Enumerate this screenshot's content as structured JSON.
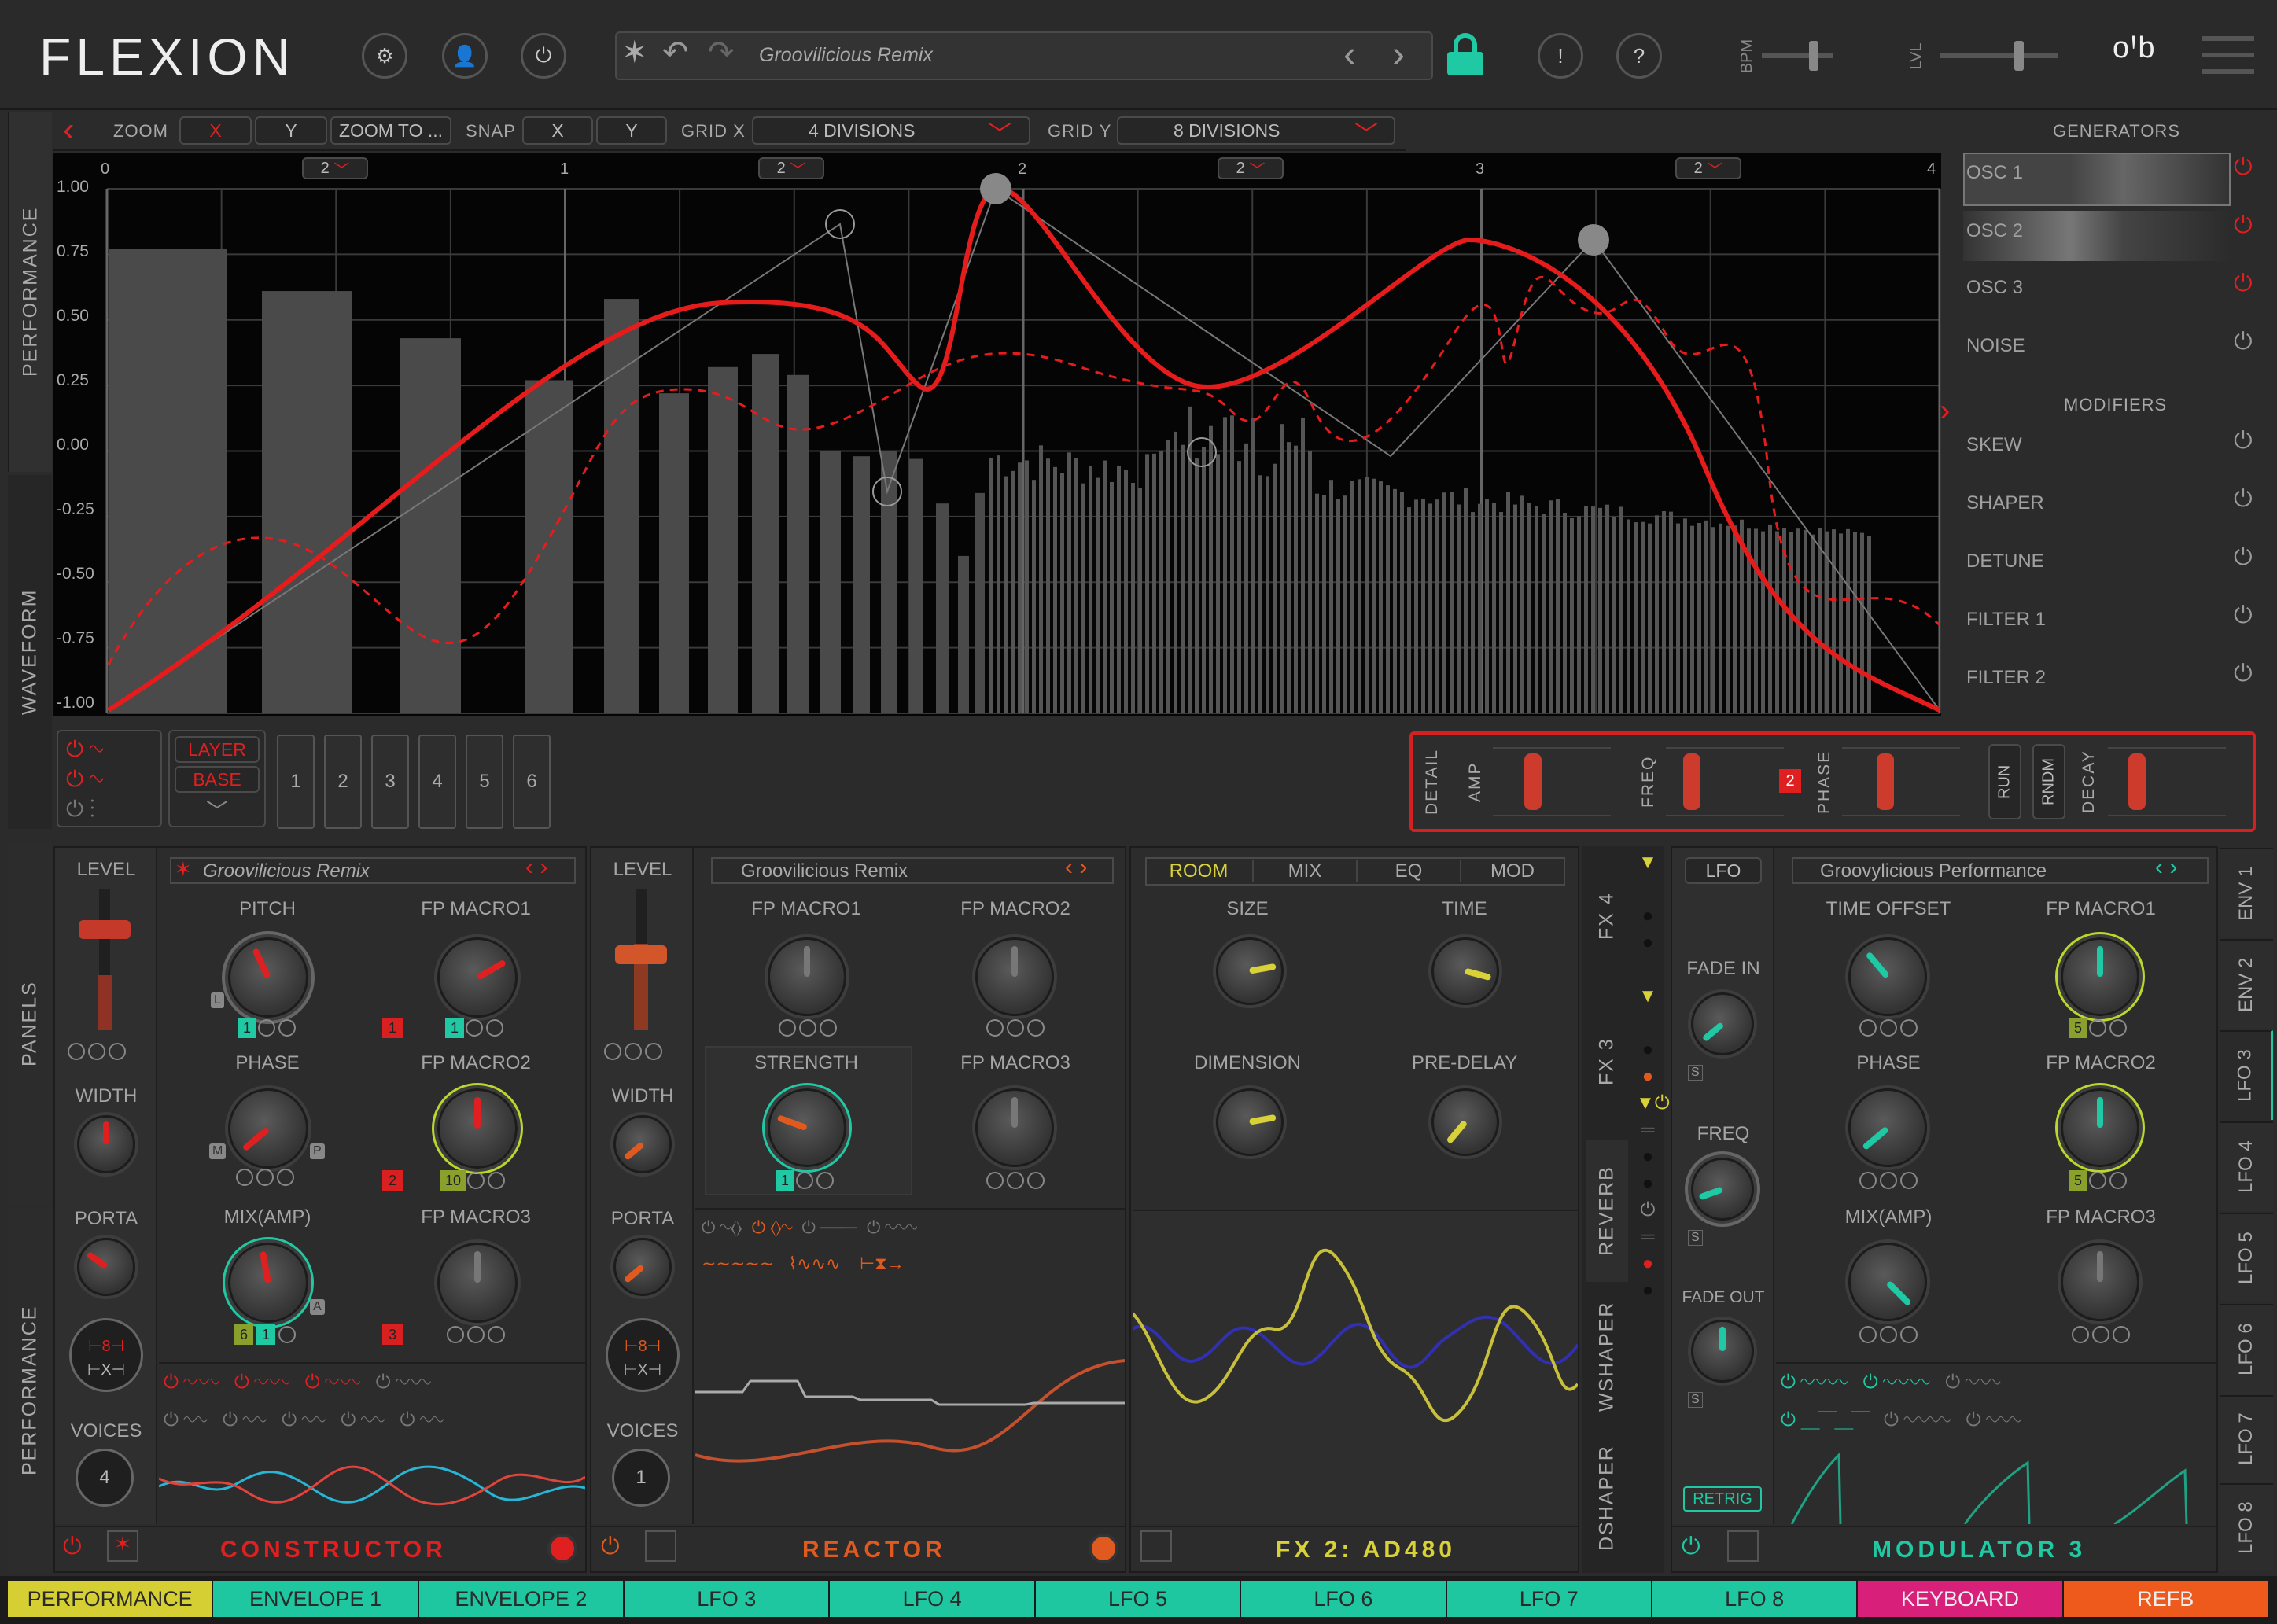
{
  "app": {
    "logo": "FLEXION",
    "preset": "Groovilicious Remix",
    "bpm_label": "BPM",
    "lvl_label": "LVL",
    "warn": "!",
    "help": "?"
  },
  "colors": {
    "accent": "#e02020",
    "teal": "#1fc9a4",
    "yellow": "#d8d238",
    "pink": "#e0237e",
    "orange": "#ee5a1c"
  },
  "toolbar": {
    "zoom": "ZOOM",
    "zoom_x": "X",
    "zoom_y": "Y",
    "zoom_to": "ZOOM TO ...",
    "snap": "SNAP",
    "snap_x": "X",
    "snap_y": "Y",
    "gridx": "GRID X",
    "gridx_val": "4 DIVISIONS",
    "gridy": "GRID Y",
    "gridy_val": "8 DIVISIONS"
  },
  "graph": {
    "x_ticks": [
      "0",
      "1",
      "2",
      "3",
      "4"
    ],
    "y_ticks": [
      "1.00",
      "0.75",
      "0.50",
      "0.25",
      "0.00",
      "-0.25",
      "-0.50",
      "-0.75",
      "-1.00"
    ],
    "sub_badges": [
      "2",
      "2",
      "2",
      "2"
    ]
  },
  "left_tabs": {
    "performance": "PERFORMANCE",
    "waveform": "WAVEFORM",
    "panels": "PANELS",
    "performance2": "PERFORMANCE"
  },
  "generators": {
    "title": "GENERATORS",
    "items": [
      "OSC 1",
      "OSC 2",
      "OSC 3",
      "NOISE"
    ],
    "mod_title": "MODIFIERS",
    "mods": [
      "SKEW",
      "SHAPER",
      "DETUNE",
      "FILTER 1",
      "FILTER 2"
    ]
  },
  "layer": {
    "layer": "LAYER",
    "base": "BASE",
    "slots": [
      "1",
      "2",
      "3",
      "4",
      "5",
      "6"
    ]
  },
  "detail": {
    "detail": "DETAIL",
    "amp": "AMP",
    "freq": "FREQ",
    "freq_badge": "2",
    "phase": "PHASE",
    "run": "RUN",
    "rndm": "RNDM",
    "decay": "DECAY"
  },
  "constructor": {
    "level": "LEVEL",
    "width": "WIDTH",
    "porta": "PORTA",
    "voices": "VOICES",
    "voices_val": "4",
    "preset": "Groovilicious Remix",
    "pitch": "PITCH",
    "phase": "PHASE",
    "mix": "MIX(AMP)",
    "m1": "FP MACRO1",
    "m2": "FP MACRO2",
    "m3": "FP MACRO3",
    "b1": "1",
    "b2": "2",
    "b3": "3",
    "p1": "1",
    "p2": "1",
    "p3": "10",
    "p4": "6",
    "p5": "1",
    "name": "CONSTRUCTOR",
    "oct1": "⊢8⊣",
    "oct2": "⊢X⊣",
    "knob_l": "L",
    "knob_m": "M",
    "knob_p": "P",
    "knob_a": "A"
  },
  "reactor": {
    "level": "LEVEL",
    "width": "WIDTH",
    "porta": "PORTA",
    "voices": "VOICES",
    "voices_val": "1",
    "preset": "Groovilicious Remix",
    "m1": "FP MACRO1",
    "m2": "FP MACRO2",
    "strength": "STRENGTH",
    "m3": "FP MACRO3",
    "badge": "1",
    "name": "REACTOR"
  },
  "fx": {
    "tabs": [
      "ROOM",
      "MIX",
      "EQ",
      "MOD"
    ],
    "size": "SIZE",
    "time": "TIME",
    "dimension": "DIMENSION",
    "predelay": "PRE-DELAY",
    "name": "FX 2: AD480",
    "side": [
      "FX 4",
      "FX 3",
      "REVERB",
      "WSHAPER",
      "DSHAPER"
    ]
  },
  "modulator": {
    "lfo": "LFO",
    "preset": "Groovylicious Performance",
    "fadein": "FADE IN",
    "freq": "FREQ",
    "fadeout": "FADE OUT",
    "retrig": "RETRIG",
    "toff": "TIME OFFSET",
    "m1": "FP MACRO1",
    "phase": "PHASE",
    "m2": "FP MACRO2",
    "mix": "MIX(AMP)",
    "m3": "FP MACRO3",
    "b1": "5",
    "b2": "5",
    "name": "MODULATOR 3",
    "s": "S"
  },
  "right_tabs": [
    "ENV 1",
    "ENV 2",
    "LFO 3",
    "LFO 4",
    "LFO 5",
    "LFO 6",
    "LFO 7",
    "LFO 8"
  ],
  "bottom_tabs": [
    {
      "label": "PERFORMANCE",
      "color": "#d6cf33"
    },
    {
      "label": "ENVELOPE 1",
      "color": "#1ec7a0"
    },
    {
      "label": "ENVELOPE 2",
      "color": "#1ec7a0"
    },
    {
      "label": "LFO 3",
      "color": "#1ec7a0"
    },
    {
      "label": "LFO 4",
      "color": "#1ec7a0"
    },
    {
      "label": "LFO 5",
      "color": "#1ec7a0"
    },
    {
      "label": "LFO 6",
      "color": "#1ec7a0"
    },
    {
      "label": "LFO 7",
      "color": "#1ec7a0"
    },
    {
      "label": "LFO 8",
      "color": "#1ec7a0"
    },
    {
      "label": "KEYBOARD",
      "color": "#d8207a"
    },
    {
      "label": "REFB",
      "color": "#ee5a1c"
    }
  ]
}
